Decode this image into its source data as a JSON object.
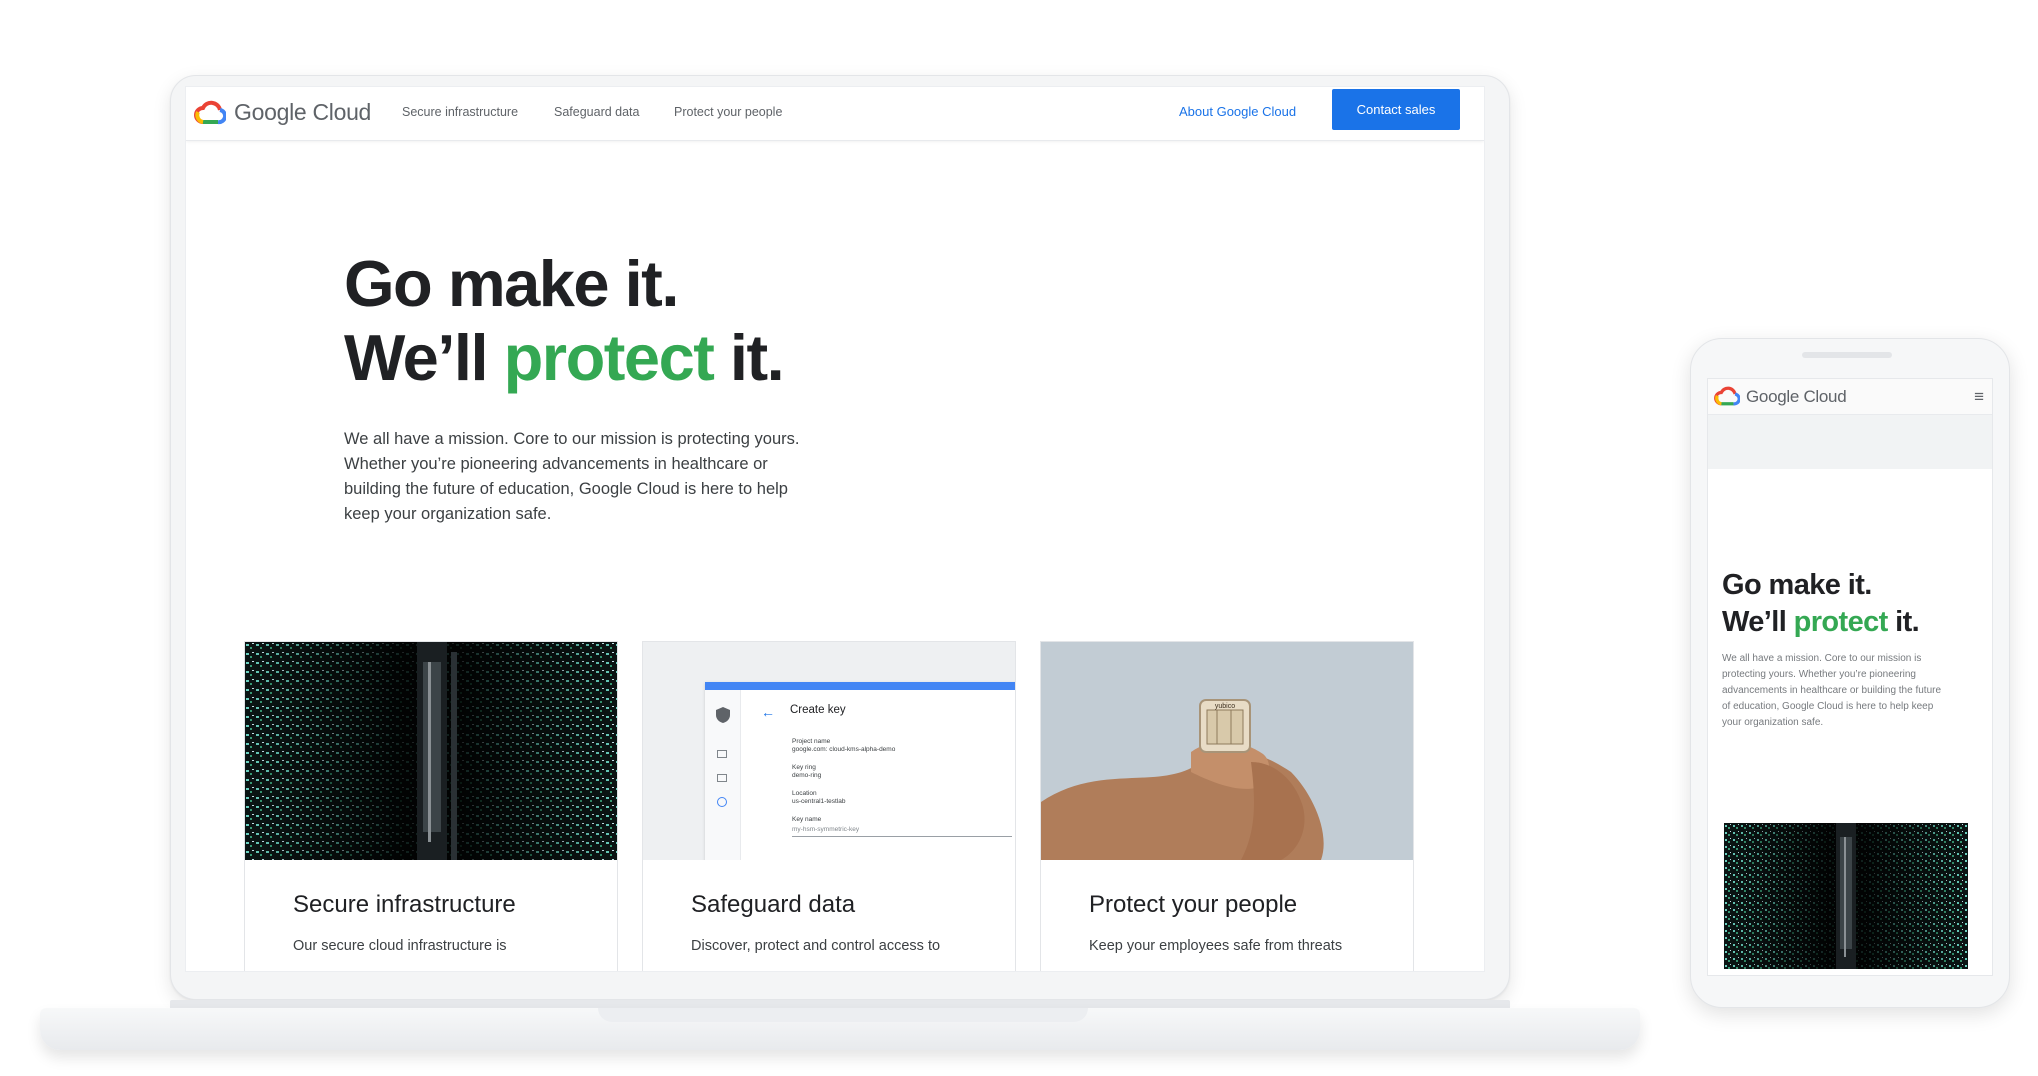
{
  "desktop": {
    "nav": {
      "brand": "Google Cloud",
      "links": [
        "Secure infrastructure",
        "Safeguard data",
        "Protect your people"
      ],
      "about": "About Google Cloud",
      "cta": "Contact sales"
    },
    "hero": {
      "line1": "Go make it.",
      "line2_before": "We’ll ",
      "line2_highlight": "protect",
      "line2_after": " it.",
      "description": "We all have a mission. Core to our mission is protecting yours. Whether you’re pioneering advancements in healthcare or building the future of education, Google Cloud is here to help keep your organization safe."
    },
    "cards": [
      {
        "title": "Secure infrastructure",
        "text": "Our secure cloud infrastructure is"
      },
      {
        "title": "Safeguard data",
        "text": "Discover, protect and control access to"
      },
      {
        "title": "Protect your people",
        "text": "Keep your employees safe from threats"
      }
    ],
    "key_form": {
      "title": "Create key",
      "fields": [
        {
          "label": "Project name",
          "value": "google.com: cloud-kms-alpha-demo"
        },
        {
          "label": "Key ring",
          "value": "demo-ring"
        },
        {
          "label": "Location",
          "value": "us-central1-testlab"
        },
        {
          "label": "Key name",
          "value": "my-hsm-symmetric-key"
        }
      ]
    },
    "key_device_label": "yubico"
  },
  "mobile": {
    "brand": "Google Cloud",
    "hero": {
      "line1": "Go make it.",
      "line2_before": "We’ll ",
      "line2_highlight": "protect",
      "line2_after": " it.",
      "description": "We all have a mission. Core to our mission is protecting yours. Whether you’re pioneering advancements in healthcare or building the future of education, Google Cloud is here to help keep your organization safe."
    }
  },
  "colors": {
    "accent_blue": "#1a73e8",
    "highlight_green": "#34a853",
    "text_dark": "#202124"
  },
  "icons": [
    "google-cloud-logo-icon",
    "hamburger-menu-icon",
    "back-arrow-icon",
    "shield-icon"
  ]
}
